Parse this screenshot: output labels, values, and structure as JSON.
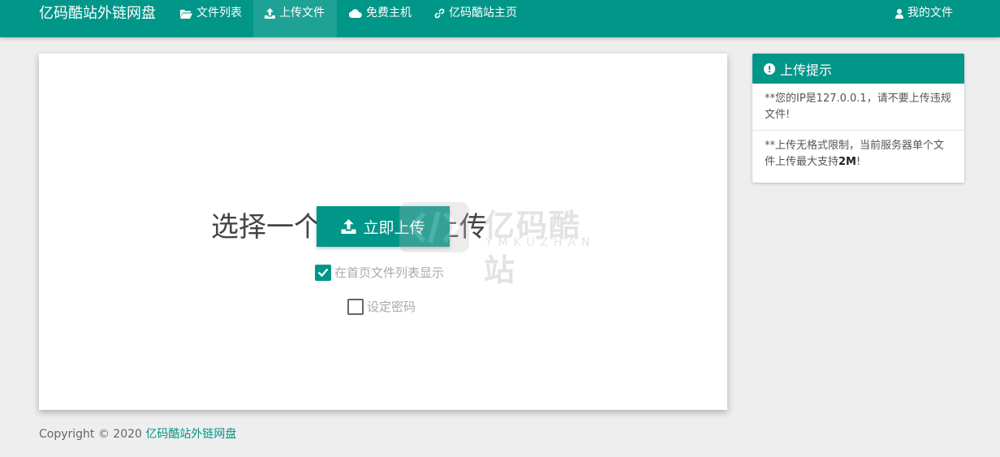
{
  "nav": {
    "brand": "亿码酷站外链网盘",
    "items": [
      {
        "label": "文件列表",
        "icon": "folder-open-icon"
      },
      {
        "label": "上传文件",
        "icon": "upload-icon",
        "active": true
      },
      {
        "label": "免费主机",
        "icon": "cloud-icon"
      },
      {
        "label": "亿码酷站主页",
        "icon": "link-icon"
      }
    ],
    "right_item": {
      "label": "我的文件",
      "icon": "user-icon"
    }
  },
  "upload": {
    "title": "选择一个文件开始上传",
    "button_label": "立即上传",
    "show_on_homepage_label": "在首页文件列表显示",
    "show_on_homepage_checked": true,
    "set_password_label": "设定密码",
    "set_password_checked": false
  },
  "watermark": {
    "text": "亿码酷站",
    "subtext": "YMKUZHAN"
  },
  "tips": {
    "title": "上传提示",
    "item1": "**您的IP是127.0.0.1，请不要上传违规文件!",
    "item2_prefix": "**上传无格式限制，当前服务器单个文件上传最大支持",
    "item2_bold": "2M",
    "item2_suffix": "!"
  },
  "footer": {
    "copyright": "Copyright © 2020 ",
    "link": "亿码酷站外链网盘"
  },
  "colors": {
    "primary": "#009688",
    "background": "#eeeeee"
  }
}
